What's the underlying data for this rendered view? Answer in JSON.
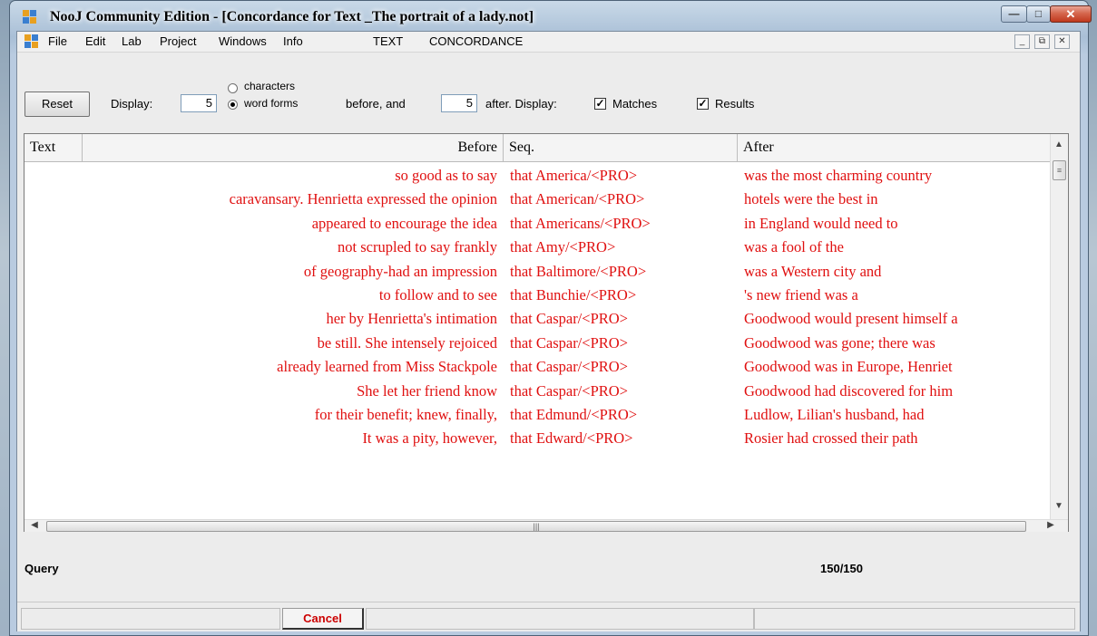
{
  "window": {
    "title": "NooJ Community Edition - [Concordance for Text _The portrait of a lady.not]"
  },
  "menu": {
    "items": [
      "File",
      "Edit",
      "Lab",
      "Project",
      "Windows",
      "Info",
      "TEXT",
      "CONCORDANCE"
    ]
  },
  "toolbar": {
    "reset_label": "Reset",
    "display_label": "Display:",
    "before_value": "5",
    "characters_label": "characters",
    "word_forms_label": "word forms",
    "unit_selected": "word forms",
    "before_and_label": "before, and",
    "after_value": "5",
    "after_display_label": "after.  Display:",
    "matches_label": "Matches",
    "matches_checked": true,
    "results_label": "Results",
    "results_checked": true
  },
  "grid": {
    "columns": [
      "Text",
      "Before",
      "Seq.",
      "After"
    ],
    "rows": [
      {
        "before": "so good as to say",
        "seq": "that America/<PRO>",
        "after": "was the most charming country"
      },
      {
        "before": "caravansary. Henrietta expressed the opinion",
        "seq": "that American/<PRO>",
        "after": "hotels were the best in"
      },
      {
        "before": "appeared to encourage the idea",
        "seq": "that Americans/<PRO>",
        "after": "in England would need to"
      },
      {
        "before": "not scrupled to say frankly",
        "seq": "that Amy/<PRO>",
        "after": "was a fool of the"
      },
      {
        "before": "of geography-had an impression",
        "seq": "that Baltimore/<PRO>",
        "after": "was a Western city and"
      },
      {
        "before": "to follow and to see",
        "seq": "that Bunchie/<PRO>",
        "after": "'s new friend was a"
      },
      {
        "before": "her by Henrietta's intimation",
        "seq": "that Caspar/<PRO>",
        "after": "Goodwood would present himself a"
      },
      {
        "before": "be still. She intensely rejoiced",
        "seq": "that Caspar/<PRO>",
        "after": "Goodwood was gone; there was"
      },
      {
        "before": "already learned from Miss Stackpole",
        "seq": "that Caspar/<PRO>",
        "after": "Goodwood was in Europe, Henriet"
      },
      {
        "before": "She let her friend know",
        "seq": "that Caspar/<PRO>",
        "after": "Goodwood had discovered for him"
      },
      {
        "before": "for their benefit; knew, finally,",
        "seq": "that Edmund/<PRO>",
        "after": "Ludlow, Lilian's husband, had"
      },
      {
        "before": "It was a pity, however,",
        "seq": "that Edward/<PRO>",
        "after": "Rosier had crossed their path"
      }
    ],
    "text_color": "#e01010"
  },
  "footer": {
    "query_label": "Query",
    "count": "150/150",
    "cancel_label": "Cancel"
  }
}
